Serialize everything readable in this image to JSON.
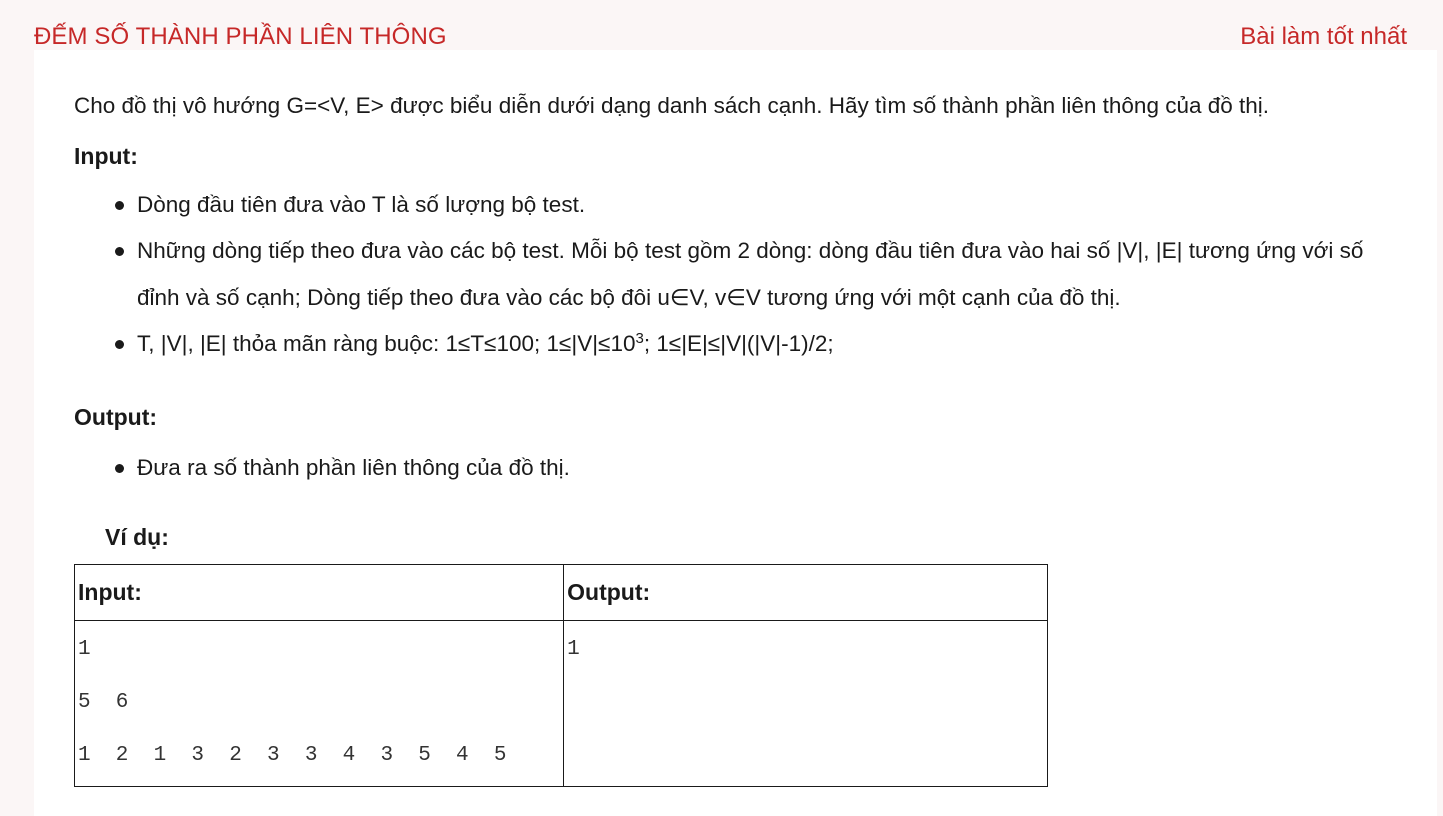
{
  "header": {
    "problem_title": "ĐẾM SỐ THÀNH PHẦN LIÊN THÔNG",
    "best_submission_link": "Bài làm tốt nhất"
  },
  "problem": {
    "intro": "Cho đồ thị vô hướng G=<V, E> được biểu diễn dưới dạng danh sách cạnh. Hãy tìm số thành phần liên thông của đồ thị.",
    "input_heading": "Input:",
    "input_items": [
      "Dòng đầu tiên đưa vào T là số lượng bộ test.",
      "Những dòng tiếp theo đưa vào các bộ test. Mỗi bộ test gồm 2 dòng: dòng đầu tiên đưa vào hai số |V|, |E| tương ứng với số",
      "đỉnh và số cạnh; Dòng tiếp theo đưa vào các bộ đôi u∈V, v∈V tương ứng với một cạnh của đồ thị."
    ],
    "constraint_prefix": "T, |V|, |E| thỏa mãn ràng buộc: 1≤T≤100; 1≤|V|≤10",
    "constraint_exp": "3",
    "constraint_suffix": "; 1≤|E|≤|V|(|V|-1)/2;",
    "output_heading": "Output:",
    "output_items": [
      "Đưa ra số thành phần liên thông của đồ thị."
    ],
    "example_label": "Ví dụ:"
  },
  "example_table": {
    "headers": [
      "Input:",
      "Output:"
    ],
    "input_lines": [
      "1",
      "5 6",
      "1 2 1 3 2 3 3 4 3 5 4 5"
    ],
    "output_lines": [
      "1"
    ]
  }
}
